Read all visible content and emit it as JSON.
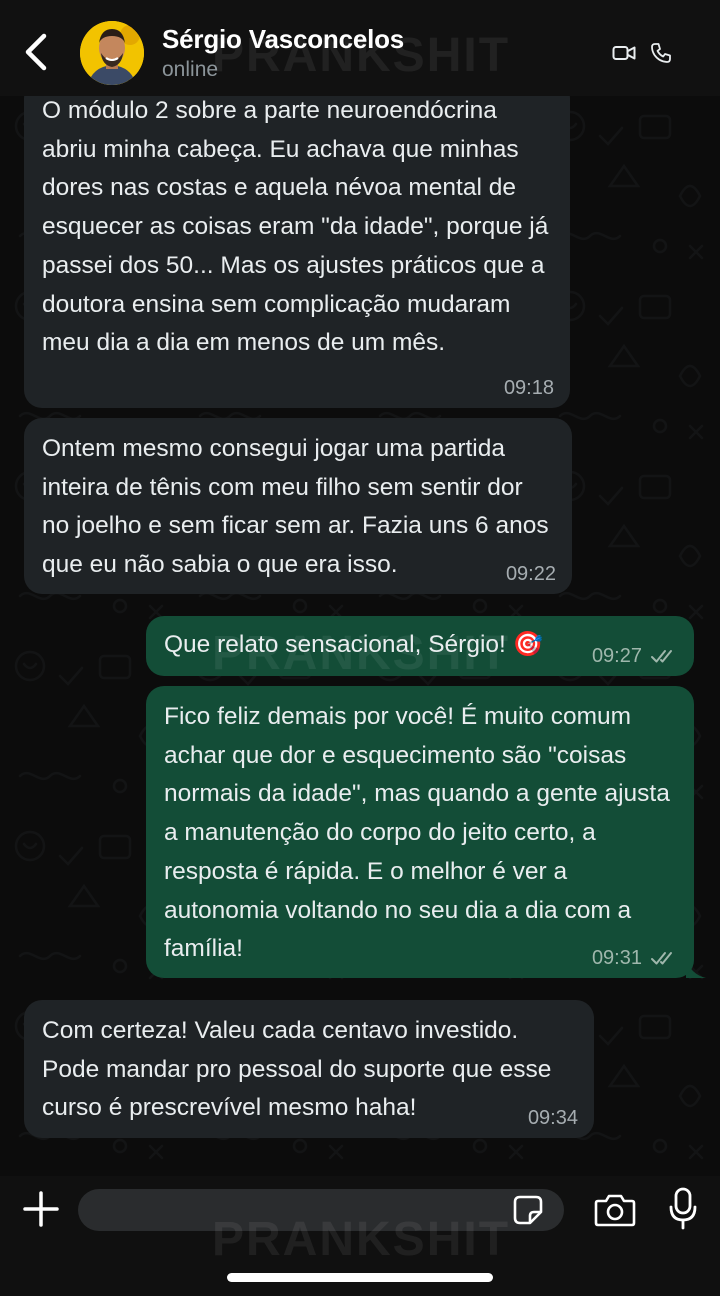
{
  "header": {
    "contact_name": "Sérgio Vasconcelos",
    "status": "online"
  },
  "watermark": "PRANKSHIT",
  "messages": [
    {
      "direction": "incoming",
      "text": "O módulo 2 sobre a parte neuroendócrina abriu minha cabeça. Eu achava que minhas dores nas costas e aquela névoa mental de esquecer as coisas eram \"da idade\", porque já passei dos 50... Mas os ajustes práticos que a doutora ensina sem complicação mudaram meu dia a dia em menos de um mês.",
      "time": "09:18"
    },
    {
      "direction": "incoming",
      "text": "Ontem mesmo consegui jogar uma partida inteira de tênis com meu filho sem sentir dor no joelho e sem ficar sem ar. Fazia uns 6 anos que eu não sabia o que era isso.",
      "time": "09:22"
    },
    {
      "direction": "outgoing",
      "text": "Que relato sensacional, Sérgio! 🎯",
      "time": "09:27"
    },
    {
      "direction": "outgoing",
      "text": "Fico feliz demais por você! É muito comum achar que dor e esquecimento são \"coisas normais da idade\", mas quando a gente ajusta a manutenção do corpo do jeito certo, a resposta é rápida. E o melhor é ver a autonomia voltando no seu dia a dia com a família!",
      "time": "09:31"
    },
    {
      "direction": "incoming",
      "text": "Com certeza! Valeu cada centavo investido. Pode mandar pro pessoal do suporte que esse curso é prescrevível mesmo haha!",
      "time": "09:34"
    }
  ],
  "composer": {
    "value": "",
    "placeholder": ""
  },
  "icons": {
    "back": "chevron-left-icon",
    "video": "video-camera-icon",
    "call": "phone-icon",
    "plus": "plus-icon",
    "sticker": "sticker-icon",
    "camera": "camera-icon",
    "mic": "microphone-icon",
    "read_receipt": "double-check-icon"
  },
  "colors": {
    "incoming_bubble": "#1f2326",
    "outgoing_bubble": "#134d37",
    "background": "#0c0c0c",
    "header": "#111111"
  }
}
